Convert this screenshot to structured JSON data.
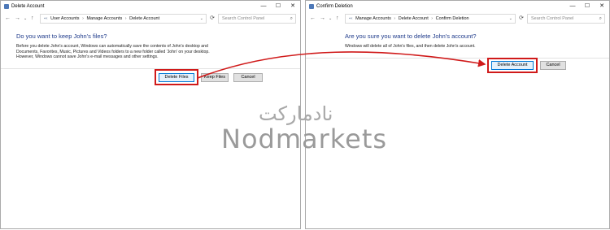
{
  "left_window": {
    "title": "Delete Account",
    "controls": {
      "minimize": "—",
      "maximize": "☐",
      "close": "✕"
    },
    "nav": {
      "back": "←",
      "forward": "→",
      "dropdown": "⌄",
      "up": "↑"
    },
    "breadcrumb": [
      "User Accounts",
      "Manage Accounts",
      "Delete Account"
    ],
    "search_placeholder": "Search Control Panel",
    "heading": "Do you want to keep John's files?",
    "body_lines": [
      "Before you delete John's account, Windows can automatically save the contents of John's desktop and",
      "Documents, Favorites, Music, Pictures and Videos folders to a new folder called 'John' on your desktop.",
      "However, Windows cannot save John's e-mail messages and other settings."
    ],
    "buttons": {
      "delete_files": "Delete Files",
      "keep_files": "Keep Files",
      "cancel": "Cancel"
    }
  },
  "right_window": {
    "title": "Confirm Deletion",
    "controls": {
      "minimize": "—",
      "maximize": "☐",
      "close": "✕"
    },
    "nav": {
      "back": "←",
      "forward": "→",
      "dropdown": "⌄",
      "up": "↑"
    },
    "breadcrumb": [
      "Manage Accounts",
      "Delete Account",
      "Confirm Deletion"
    ],
    "search_placeholder": "Search Control Panel",
    "heading": "Are you sure you want to delete John's account?",
    "body_lines": [
      "Windows will delete all of John's files, and then delete John's account."
    ],
    "buttons": {
      "delete_account": "Delete Account",
      "cancel": "Cancel"
    }
  },
  "watermark": {
    "persian": "نادمارکت",
    "english": "Nodmarkets"
  },
  "colors": {
    "highlight": "#d01a1a",
    "heading": "#1e3a8a",
    "arrow": "#d01a1a"
  },
  "icons": [
    "control-panel-icon",
    "back-arrow-icon",
    "forward-arrow-icon",
    "up-arrow-icon",
    "refresh-icon",
    "search-icon"
  ]
}
